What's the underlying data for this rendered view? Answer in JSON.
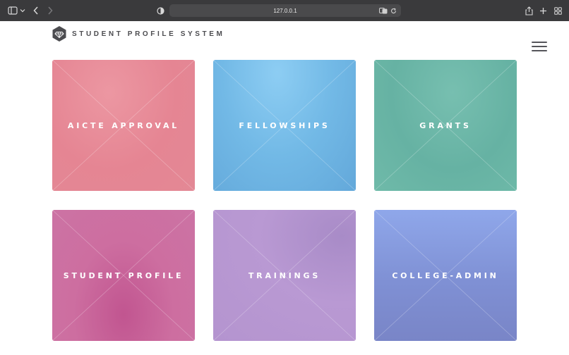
{
  "browser": {
    "url": "127.0.0.1"
  },
  "header": {
    "title": "STUDENT PROFILE SYSTEM"
  },
  "tiles": [
    {
      "label": "AICTE APPROVAL"
    },
    {
      "label": "FELLOWSHIPS"
    },
    {
      "label": "GRANTS"
    },
    {
      "label": "STUDENT PROFILE"
    },
    {
      "label": "TRAININGS"
    },
    {
      "label": "COLLEGE-ADMIN"
    }
  ],
  "colors": {
    "browser_chrome": "#3a3a3c",
    "logo": "#4c4c50",
    "aicte": "#e68a97",
    "fellowships": "#72b9e6",
    "grants": "#69b5a6",
    "student_profile": "#cb6a9f",
    "trainings": "#b596d0",
    "college_admin": "#818fd4"
  },
  "icons": [
    "sidebar-icon",
    "back-icon",
    "forward-icon",
    "shield-icon",
    "translate-icon",
    "reload-icon",
    "share-icon",
    "new-tab-icon",
    "tab-overview-icon",
    "diamond-logo-icon",
    "hamburger-menu-icon"
  ]
}
